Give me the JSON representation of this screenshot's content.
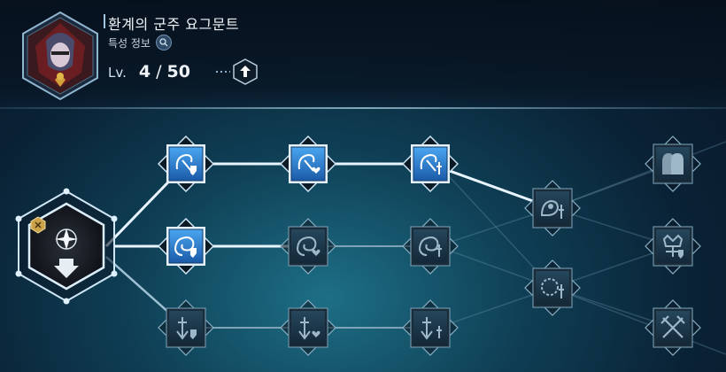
{
  "character": {
    "name": "환계의 군주 요그문트",
    "info_label": "특성 정보",
    "level_label": "Lv.",
    "level_current": "4",
    "level_max": "50"
  },
  "colors": {
    "active_line": "#e8f4ff",
    "inactive_line": "#7fa4b8",
    "active_icon_bg": "#2a78c8",
    "inactive_icon_bg": "#1b3547"
  },
  "skill_tree": {
    "root": {
      "name": "root-node",
      "icon": "sparkle-arrow-icon",
      "unlocked": true
    },
    "nodes": [
      {
        "id": "r1c1",
        "icon": "swirl-shield-icon",
        "unlocked": true
      },
      {
        "id": "r1c2",
        "icon": "swirl-heart-icon",
        "unlocked": true
      },
      {
        "id": "r1c3",
        "icon": "swirl-sword-icon",
        "unlocked": true
      },
      {
        "id": "r2c1",
        "icon": "vortex-shield-icon",
        "unlocked": true
      },
      {
        "id": "r2c2",
        "icon": "vortex-heart-icon",
        "unlocked": false
      },
      {
        "id": "r2c3",
        "icon": "vortex-sword-icon",
        "unlocked": false
      },
      {
        "id": "r3c1",
        "icon": "blade-shield-icon",
        "unlocked": false
      },
      {
        "id": "r3c2",
        "icon": "blade-heart-icon",
        "unlocked": false
      },
      {
        "id": "r3c3",
        "icon": "blade-sword-icon",
        "unlocked": false
      },
      {
        "id": "mid-upper",
        "icon": "creature-sword-icon",
        "unlocked": false
      },
      {
        "id": "mid-lower",
        "icon": "ring-sword-icon",
        "unlocked": false
      },
      {
        "id": "end-top",
        "icon": "hooded-figures-icon",
        "unlocked": false
      },
      {
        "id": "end-mid",
        "icon": "crown-tree-icon",
        "unlocked": false
      },
      {
        "id": "end-bottom",
        "icon": "crossed-swords-icon",
        "unlocked": false
      }
    ]
  }
}
